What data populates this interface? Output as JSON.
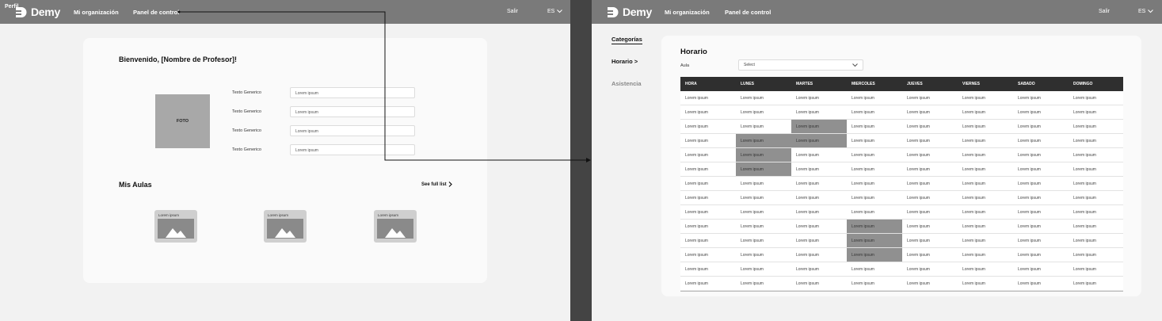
{
  "left": {
    "perfil_tag": "Perfil",
    "brand": "Demy",
    "nav": [
      "Mi organización",
      "Panel de control"
    ],
    "salir": "Salir",
    "lang": "ES",
    "welcome": "Bienvenido, [Nombre de Profesor]!",
    "photo_label": "FOTO",
    "fields": [
      {
        "label": "Texto Generico",
        "value": "Lorem ipsum"
      },
      {
        "label": "Texto Generico",
        "value": "Lorem ipsum"
      },
      {
        "label": "Texto Generico",
        "value": "Lorem ipsum"
      },
      {
        "label": "Texto Generico",
        "value": "Lorem ipsum"
      }
    ],
    "aulas_title": "Mis Aulas",
    "full_list": "See full list",
    "aulas": [
      {
        "label": "Lorem ipsum"
      },
      {
        "label": "Lorem ipsum"
      },
      {
        "label": "Lorem ipsum"
      }
    ]
  },
  "right": {
    "brand": "Demy",
    "nav": [
      "Mi organización",
      "Panel de control"
    ],
    "salir": "Salir",
    "lang": "ES",
    "sidebar": [
      {
        "label": "Categorías"
      },
      {
        "label": "Horario >"
      },
      {
        "label": "Asistencia"
      }
    ],
    "horario_title": "Horario",
    "aula_label": "Aula",
    "select_value": "Select",
    "table": {
      "headers": [
        "HORA",
        "LUNES",
        "MARTES",
        "MIERCOLES",
        "JUEVES",
        "VIERNES",
        "SABADO",
        "DOMINGO"
      ],
      "cell_text": "Lorem ipsum",
      "row_count": 14,
      "highlighted": [
        [
          2,
          2
        ],
        [
          3,
          1
        ],
        [
          3,
          2
        ],
        [
          4,
          1
        ],
        [
          5,
          1
        ],
        [
          9,
          3
        ],
        [
          10,
          3
        ],
        [
          11,
          3
        ]
      ]
    }
  },
  "colors": {
    "topbar": "#7a7a7a",
    "table_header": "#2f2f2f",
    "highlight": "#909090"
  }
}
